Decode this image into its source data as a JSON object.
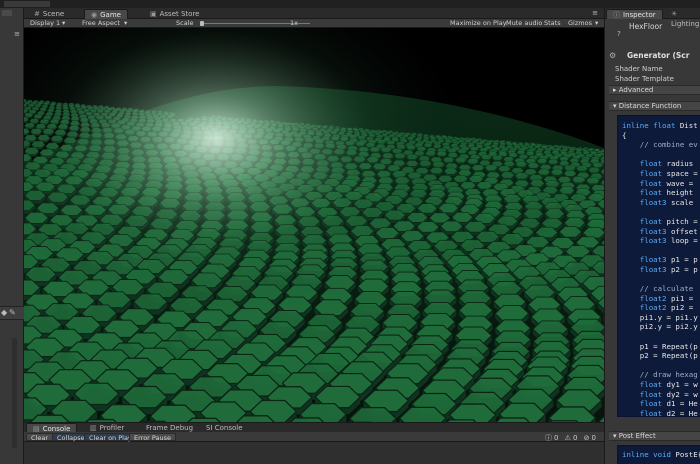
{
  "scene_tabs": {
    "scene": "Scene",
    "game": "Game",
    "asset_store": "Asset Store"
  },
  "game_toolbar": {
    "display": "Display 1",
    "aspect": "Free Aspect",
    "scale_label": "Scale",
    "scale_value": "1x",
    "maximize_on_play": "Maximize on Play",
    "mute_audio": "Mute audio",
    "stats": "Stats",
    "gizmos": "Gizmos"
  },
  "inspector": {
    "tabs": [
      "Inspector",
      "Lighting"
    ],
    "object_name": "HexFloor",
    "component_title": "Generator (Scr",
    "shader_name_label": "Shader Name",
    "shader_template_label": "Shader Template",
    "advanced_label": "Advanced",
    "distance_function_label": "Distance Function",
    "post_effect_label": "Post Effect",
    "code_lines": [
      [
        [
          "kw",
          "inline float "
        ],
        [
          "tx",
          "Dist"
        ]
      ],
      [
        [
          "tx",
          "{"
        ]
      ],
      [
        [
          "cm",
          "    // combine ev"
        ]
      ],
      [
        [
          "tx",
          ""
        ]
      ],
      [
        [
          "kw",
          "    float "
        ],
        [
          "tx",
          "radius"
        ]
      ],
      [
        [
          "kw",
          "    float "
        ],
        [
          "tx",
          "space ="
        ]
      ],
      [
        [
          "kw",
          "    float "
        ],
        [
          "tx",
          "wave ="
        ]
      ],
      [
        [
          "kw",
          "    float "
        ],
        [
          "tx",
          "height"
        ]
      ],
      [
        [
          "kw",
          "    float3 "
        ],
        [
          "tx",
          "scale"
        ]
      ],
      [
        [
          "tx",
          ""
        ]
      ],
      [
        [
          "kw",
          "    float "
        ],
        [
          "tx",
          "pitch ="
        ]
      ],
      [
        [
          "kw",
          "    float3 "
        ],
        [
          "tx",
          "offset"
        ]
      ],
      [
        [
          "kw",
          "    float3 "
        ],
        [
          "tx",
          "loop ="
        ]
      ],
      [
        [
          "tx",
          ""
        ]
      ],
      [
        [
          "kw",
          "    float3 "
        ],
        [
          "tx",
          "p1 = p"
        ]
      ],
      [
        [
          "kw",
          "    float3 "
        ],
        [
          "tx",
          "p2 = p"
        ]
      ],
      [
        [
          "tx",
          ""
        ]
      ],
      [
        [
          "cm",
          "    // calculate"
        ]
      ],
      [
        [
          "kw",
          "    float2 "
        ],
        [
          "tx",
          "pi1 ="
        ]
      ],
      [
        [
          "kw",
          "    float2 "
        ],
        [
          "tx",
          "pi2 ="
        ]
      ],
      [
        [
          "tx",
          "    pi1.y = pi1.y"
        ]
      ],
      [
        [
          "tx",
          "    pi2.y = pi2.y"
        ]
      ],
      [
        [
          "tx",
          ""
        ]
      ],
      [
        [
          "tx",
          "    p1 = Repeat(p"
        ]
      ],
      [
        [
          "tx",
          "    p2 = Repeat(p"
        ]
      ],
      [
        [
          "tx",
          ""
        ]
      ],
      [
        [
          "cm",
          "    // draw hexag"
        ]
      ],
      [
        [
          "kw",
          "    float "
        ],
        [
          "tx",
          "dy1 = w"
        ]
      ],
      [
        [
          "kw",
          "    float "
        ],
        [
          "tx",
          "dy2 = w"
        ]
      ],
      [
        [
          "kw",
          "    float "
        ],
        [
          "tx",
          "d1 = He"
        ]
      ],
      [
        [
          "kw",
          "    float "
        ],
        [
          "tx",
          "d2 = He"
        ]
      ]
    ],
    "post_code_lines": [
      [
        [
          "kw",
          "inline void "
        ],
        [
          "tx",
          "PostE"
        ]
      ],
      [
        [
          "tx",
          "{"
        ]
      ]
    ]
  },
  "console": {
    "tabs": [
      "Console",
      "Profiler",
      "Frame Debug",
      "SI Console"
    ],
    "clear": "Clear",
    "collapse": "Collapse",
    "clear_on_play": "Clear on Play",
    "error_pause": "Error Pause",
    "count_info": "0",
    "count_warning": "0",
    "count_error": "0"
  },
  "colors": {
    "hex_top_far": "#2f6e46",
    "hex_top_near": "#1f6b3a",
    "hex_side": "#0f3320",
    "highlight": "#cfeedc",
    "code_bg": "#0d1a3a",
    "keyword": "#5aaefc"
  }
}
